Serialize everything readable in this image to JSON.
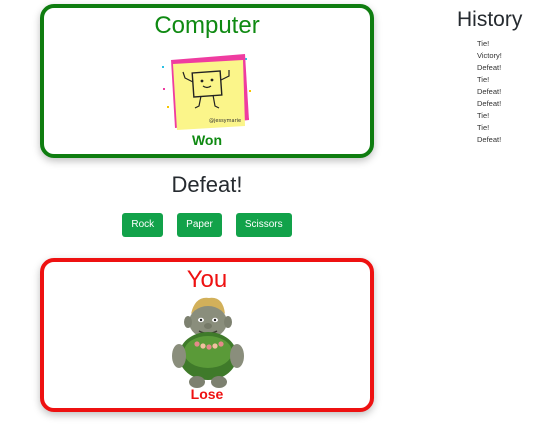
{
  "computer": {
    "title": "Computer",
    "status": "Won",
    "avatar_icon": "sticky-note-paper-icon",
    "avatar_caption": "@jessymarie",
    "border_color": "#0f7d10"
  },
  "result": "Defeat!",
  "choices": [
    "Rock",
    "Paper",
    "Scissors"
  ],
  "you": {
    "title": "You",
    "status": "Lose",
    "avatar_icon": "troll-rock-icon",
    "border_color": "#ee1111"
  },
  "history": {
    "title": "History",
    "items": [
      "Tie!",
      "Victory!",
      "Defeat!",
      "Tie!",
      "Defeat!",
      "Defeat!",
      "Tie!",
      "Tie!",
      "Defeat!"
    ]
  },
  "colors": {
    "button": "#12a24a",
    "win": "#0f8a12",
    "lose": "#ee1111"
  }
}
